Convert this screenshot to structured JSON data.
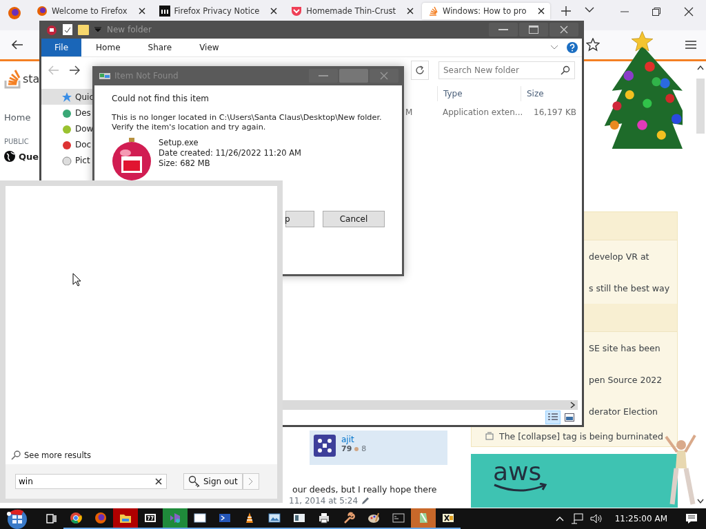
{
  "browser": {
    "tabs": [
      {
        "label": "Welcome to Firefox",
        "selected": false
      },
      {
        "label": "Firefox Privacy Notice",
        "selected": false
      },
      {
        "label": "Homemade Thin-Crust",
        "selected": false
      },
      {
        "label": "Windows: How to pro",
        "selected": true
      }
    ],
    "page": {
      "logo_text": "sta",
      "nav": [
        {
          "label": "Home",
          "kind": "item"
        },
        {
          "label": "PUBLIC",
          "kind": "heading"
        },
        {
          "label": "Que",
          "kind": "current"
        }
      ],
      "sidebar": [
        {
          "kind": "header"
        },
        {
          "kind": "item",
          "text": "develop VR at"
        },
        {
          "kind": "item",
          "text": "s still the best way"
        },
        {
          "kind": "header"
        },
        {
          "kind": "item",
          "text": "SE site has been"
        },
        {
          "kind": "item",
          "text": "pen Source 2022"
        },
        {
          "kind": "item",
          "text": "derator Election"
        },
        {
          "kind": "item",
          "text": "The [collapse] tag is being burninated"
        }
      ],
      "user_card": {
        "name": "ajit",
        "reputation": "79",
        "bronze": "8"
      },
      "post_text": "our deeds, but I really hope there",
      "post_date": "11, 2014 at 5:24",
      "ad_logo": "aws"
    }
  },
  "explorer": {
    "title": "New folder",
    "ribbon_tabs": [
      {
        "label": "File",
        "selected": true
      },
      {
        "label": "Home",
        "selected": false
      },
      {
        "label": "Share",
        "selected": false
      },
      {
        "label": "View",
        "selected": false
      }
    ],
    "search_placeholder": "Search New folder",
    "nav_items": [
      {
        "label": "Quic",
        "selected": true
      },
      {
        "label": "Des",
        "selected": false
      },
      {
        "label": "Dow",
        "selected": false
      },
      {
        "label": "Doc",
        "selected": false
      },
      {
        "label": "Pict",
        "selected": false
      }
    ],
    "columns": [
      "Type",
      "Size"
    ],
    "rows": [
      {
        "column_1": "M",
        "type": "Application exten...",
        "size": "16,197 KB"
      }
    ]
  },
  "dialog": {
    "title": "Item Not Found",
    "heading": "Could not find this item",
    "message": [
      "This is no longer located in C:\\Users\\Santa Claus\\Desktop\\New folder.",
      "Verify the item's location and try again."
    ],
    "file": [
      "Setup.exe",
      "Date created: 11/26/2022 11:20 AM",
      "Size: 682 MB"
    ],
    "buttons": [
      "p",
      "Cancel"
    ]
  },
  "start_menu": {
    "more_results": "See more results",
    "search_value": "win",
    "sign_out": "Sign out"
  },
  "taskbar": {
    "apps": [
      {
        "running": false
      },
      {
        "running": true
      },
      {
        "running": true
      },
      {
        "running": true,
        "color": "#b00000"
      },
      {
        "running": true
      },
      {
        "running": true,
        "color": "#1f8a3a"
      },
      {
        "running": true
      },
      {
        "running": true
      },
      {
        "running": true
      },
      {
        "running": true
      },
      {
        "running": true
      },
      {
        "running": true
      },
      {
        "running": true
      },
      {
        "running": true
      },
      {
        "running": true
      },
      {
        "running": true,
        "color": "#c8682a"
      },
      {
        "running": true
      }
    ],
    "time": "11:25:00 AM"
  }
}
